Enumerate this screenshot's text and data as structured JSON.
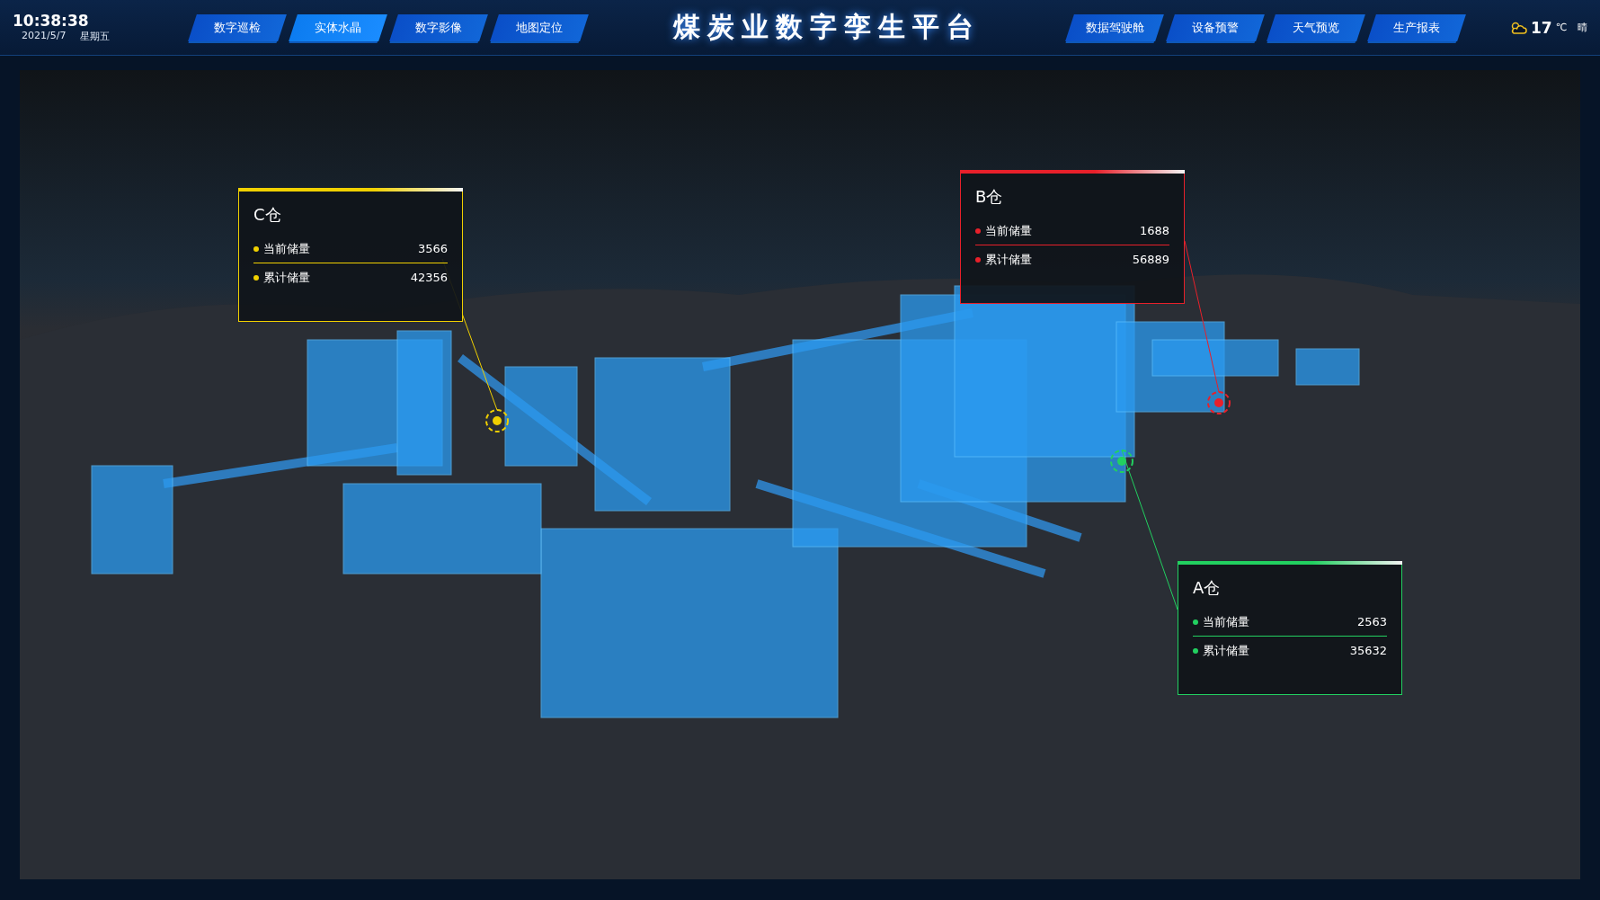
{
  "header": {
    "time": "10:38:38",
    "date": "2021/5/7",
    "weekday": "星期五",
    "title": "煤炭业数字孪生平台",
    "weather": {
      "temperature": "17",
      "unit": "℃",
      "condition": "晴"
    }
  },
  "nav_left": [
    {
      "label": "数字巡检",
      "selected": false
    },
    {
      "label": "实体水晶",
      "selected": true
    },
    {
      "label": "数字影像",
      "selected": false
    },
    {
      "label": "地图定位",
      "selected": false
    }
  ],
  "nav_right": [
    {
      "label": "数据驾驶舱",
      "selected": false
    },
    {
      "label": "设备预警",
      "selected": false
    },
    {
      "label": "天气预览",
      "selected": false
    },
    {
      "label": "生产报表",
      "selected": false
    }
  ],
  "warehouses": [
    {
      "name": "C仓",
      "color": "#f0d000",
      "metrics": [
        {
          "label": "当前储量",
          "value": "3566"
        },
        {
          "label": "累计储量",
          "value": "42356"
        }
      ]
    },
    {
      "name": "B仓",
      "color": "#e8202a",
      "metrics": [
        {
          "label": "当前储量",
          "value": "1688"
        },
        {
          "label": "累计储量",
          "value": "56889"
        }
      ]
    },
    {
      "name": "A仓",
      "color": "#22d060",
      "metrics": [
        {
          "label": "当前储量",
          "value": "2563"
        },
        {
          "label": "累计储量",
          "value": "35632"
        }
      ]
    }
  ]
}
